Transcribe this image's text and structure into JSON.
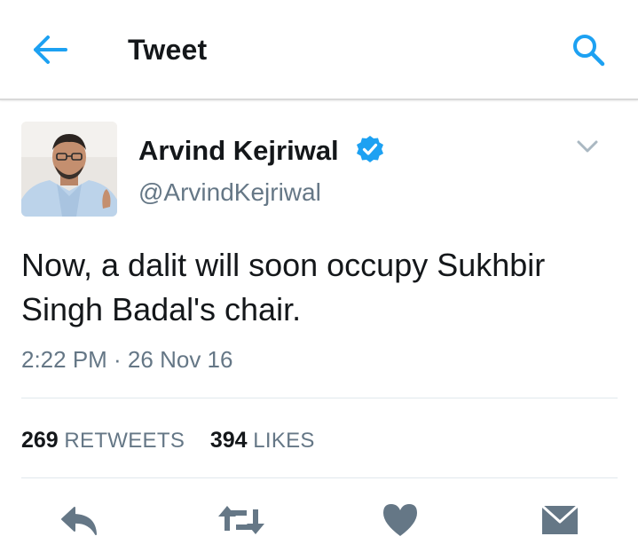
{
  "header": {
    "title": "Tweet",
    "back_icon": "arrow-left-icon",
    "search_icon": "search-icon"
  },
  "author": {
    "name": "Arvind Kejriwal",
    "handle": "@ArvindKejriwal",
    "verified": true
  },
  "tweet": {
    "text": "Now, a dalit will soon occupy Sukhbir Singh Badal's chair.",
    "timestamp": "2:22 PM · 26 Nov 16"
  },
  "stats": {
    "retweets_count": "269",
    "retweets_label": "RETWEETS",
    "likes_count": "394",
    "likes_label": "LIKES"
  },
  "actions": [
    "reply-icon",
    "retweet-icon",
    "heart-icon",
    "message-icon"
  ],
  "colors": {
    "accent": "#1da1f2",
    "text": "#14171a",
    "secondary": "#657786",
    "action_icon": "#657786",
    "divider": "#e1e8ed"
  }
}
